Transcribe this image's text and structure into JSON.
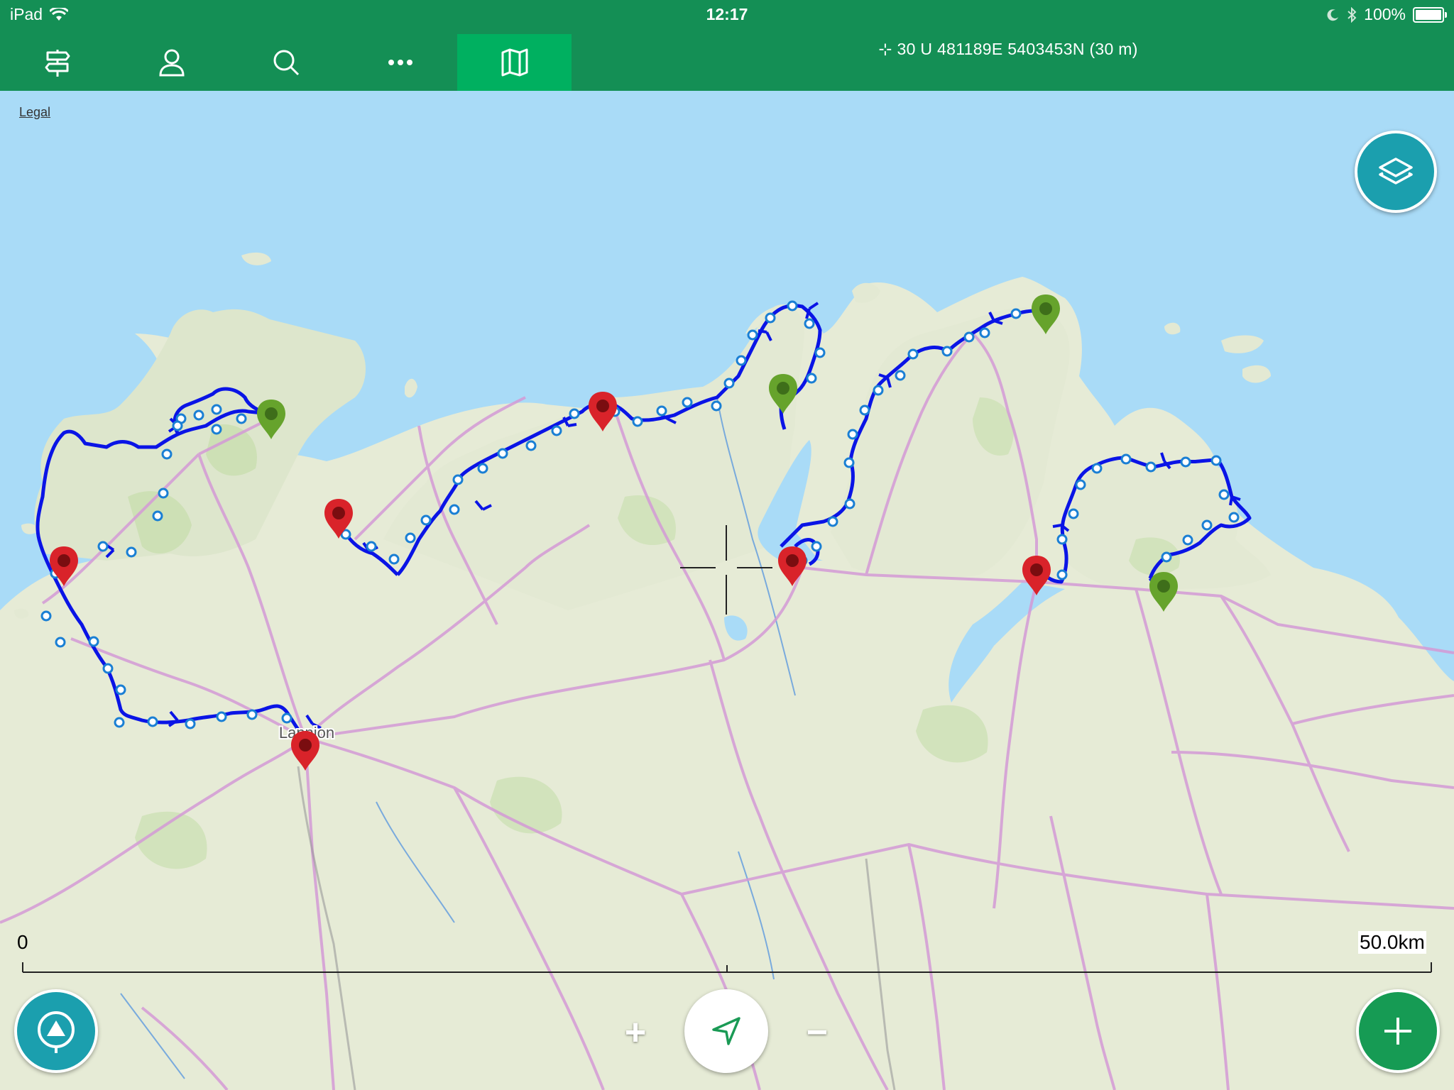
{
  "status_bar": {
    "device": "iPad",
    "time": "12:17",
    "battery": "100%",
    "battery_level": 1.0,
    "icons": [
      "wifi-icon",
      "moon-icon",
      "bluetooth-icon",
      "battery-icon"
    ]
  },
  "toolbar": {
    "buttons": [
      {
        "name": "routes-button",
        "icon": "signpost-icon",
        "active": false
      },
      {
        "name": "profile-button",
        "icon": "person-icon",
        "active": false
      },
      {
        "name": "search-button",
        "icon": "search-icon",
        "active": false
      },
      {
        "name": "more-button",
        "icon": "ellipsis-icon",
        "active": false
      },
      {
        "name": "map-button",
        "icon": "map-icon",
        "active": true
      }
    ],
    "coordinates": "⊹ 30 U 481189E 5403453N  (30 m)"
  },
  "map": {
    "legal_link": "Legal",
    "city_label": "Lannion",
    "scale": {
      "start": "0",
      "end": "50.0km"
    },
    "colors": {
      "sea": "#a9dbf7",
      "land": "#e6ebd6",
      "road": "#d49ad6",
      "track": "#0a14e6",
      "marker_red": "#d9232a",
      "marker_green": "#66a32c"
    },
    "markers": [
      {
        "color": "green"
      },
      {
        "color": "red"
      },
      {
        "color": "red"
      },
      {
        "color": "red"
      },
      {
        "color": "green"
      },
      {
        "color": "red"
      },
      {
        "color": "green"
      },
      {
        "color": "red"
      },
      {
        "color": "green"
      },
      {
        "color": "red"
      }
    ]
  },
  "controls": {
    "zoom_in": "+",
    "zoom_out": "−",
    "icons": [
      "layers-icon",
      "track-recording-icon",
      "location-arrow-icon",
      "plus-icon"
    ]
  }
}
